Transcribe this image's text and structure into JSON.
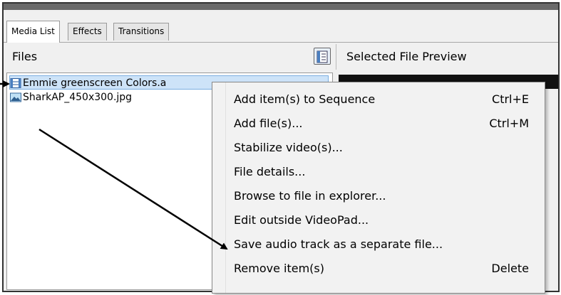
{
  "tabs": [
    {
      "label": "Media List"
    },
    {
      "label": "Effects"
    },
    {
      "label": "Transitions"
    }
  ],
  "files_panel": {
    "title": "Files",
    "items": [
      {
        "name": "Emmie greenscreen Colors.a",
        "icon": "video-file-icon",
        "selected": true
      },
      {
        "name": "SharkAP_450x300.jpg",
        "icon": "image-file-icon",
        "selected": false
      }
    ]
  },
  "preview_panel": {
    "title": "Selected File Preview"
  },
  "context_menu": {
    "items": [
      {
        "label": "Add item(s) to Sequence",
        "shortcut": "Ctrl+E"
      },
      {
        "label": "Add file(s)...",
        "shortcut": "Ctrl+M"
      },
      {
        "label": "Stabilize video(s)...",
        "shortcut": ""
      },
      {
        "label": "File details...",
        "shortcut": ""
      },
      {
        "label": "Browse to file in explorer...",
        "shortcut": ""
      },
      {
        "label": "Edit outside VideoPad...",
        "shortcut": ""
      },
      {
        "label": "Save audio track as a separate file...",
        "shortcut": ""
      },
      {
        "label": "Remove item(s)",
        "shortcut": "Delete"
      }
    ]
  },
  "colors": {
    "selection": "#cde3f8",
    "menu_bg": "#f2f2f2",
    "annotation_arrow": "#000000"
  }
}
